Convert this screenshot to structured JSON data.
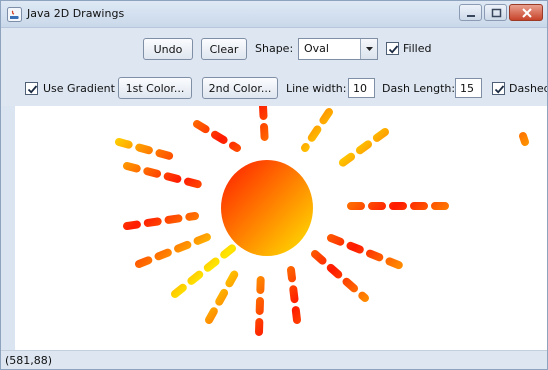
{
  "window": {
    "title": "Java 2D Drawings"
  },
  "toolbar": {
    "undo_label": "Undo",
    "clear_label": "Clear",
    "shape_label": "Shape:",
    "shape_value": "Oval",
    "filled_label": "Filled",
    "filled_checked": true,
    "use_gradient_label": "Use Gradient",
    "use_gradient_checked": true,
    "color1_label": "1st Color...",
    "color2_label": "2nd Color...",
    "line_width_label": "Line width:",
    "line_width_value": "10",
    "dash_length_label": "Dash Length:",
    "dash_length_value": "15",
    "dashed_label": "Dashed",
    "dashed_checked": true
  },
  "colors": {
    "gradient_start": "#ff1a00",
    "gradient_end": "#ffe600"
  },
  "status": {
    "coordinates": "(581,88)"
  }
}
